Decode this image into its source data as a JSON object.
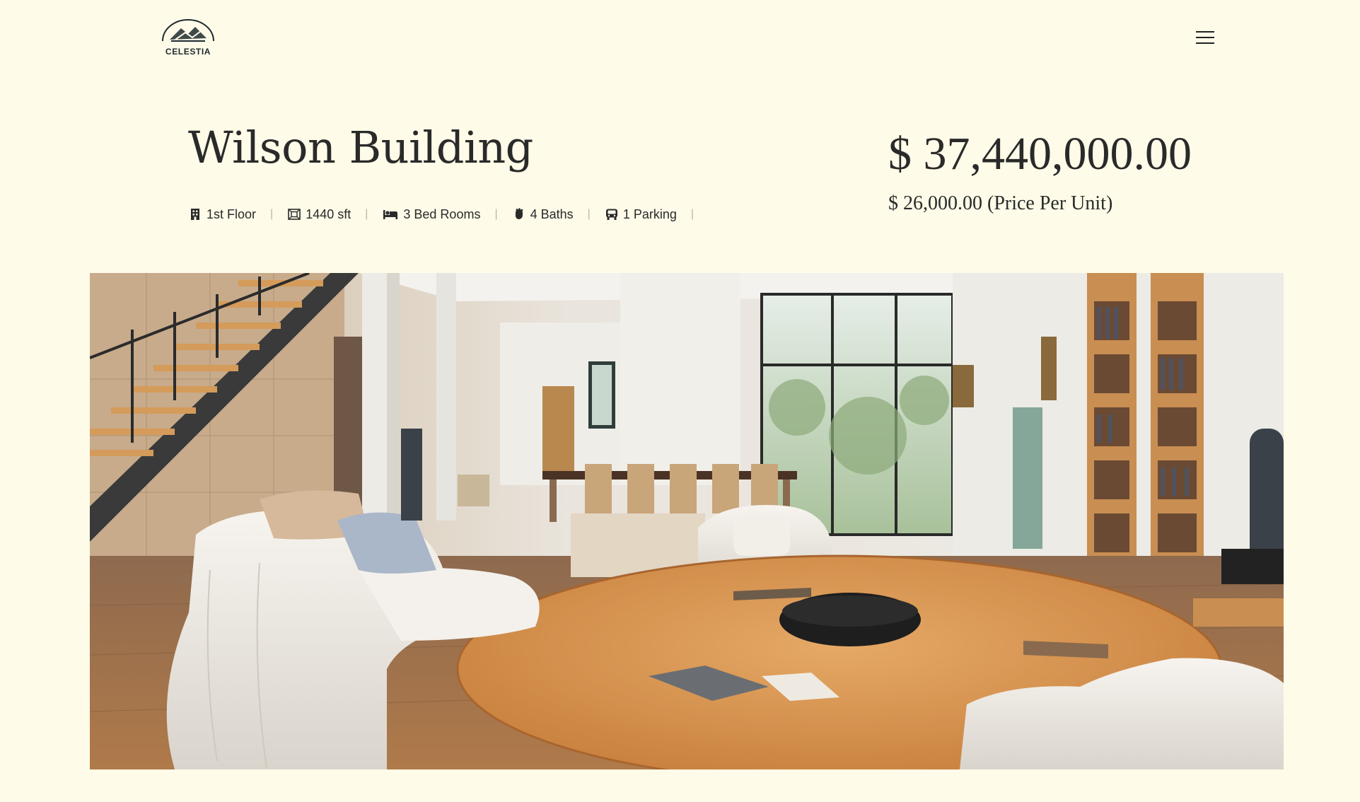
{
  "brand": {
    "name": "CELESTIA"
  },
  "property": {
    "title": "Wilson Building",
    "price": "$ 37,440,000.00",
    "unit_price": "$ 26,000.00 (Price Per Unit)"
  },
  "features": [
    {
      "icon": "building-icon",
      "label": "1st Floor"
    },
    {
      "icon": "area-icon",
      "label": "1440 sft"
    },
    {
      "icon": "bed-icon",
      "label": "3 Bed Rooms"
    },
    {
      "icon": "bath-icon",
      "label": "4 Baths"
    },
    {
      "icon": "car-icon",
      "label": "1 Parking"
    }
  ],
  "separator": "|",
  "colors": {
    "background": "#fefbe8",
    "text": "#2a2a2a",
    "separator": "#b9b6a6"
  }
}
